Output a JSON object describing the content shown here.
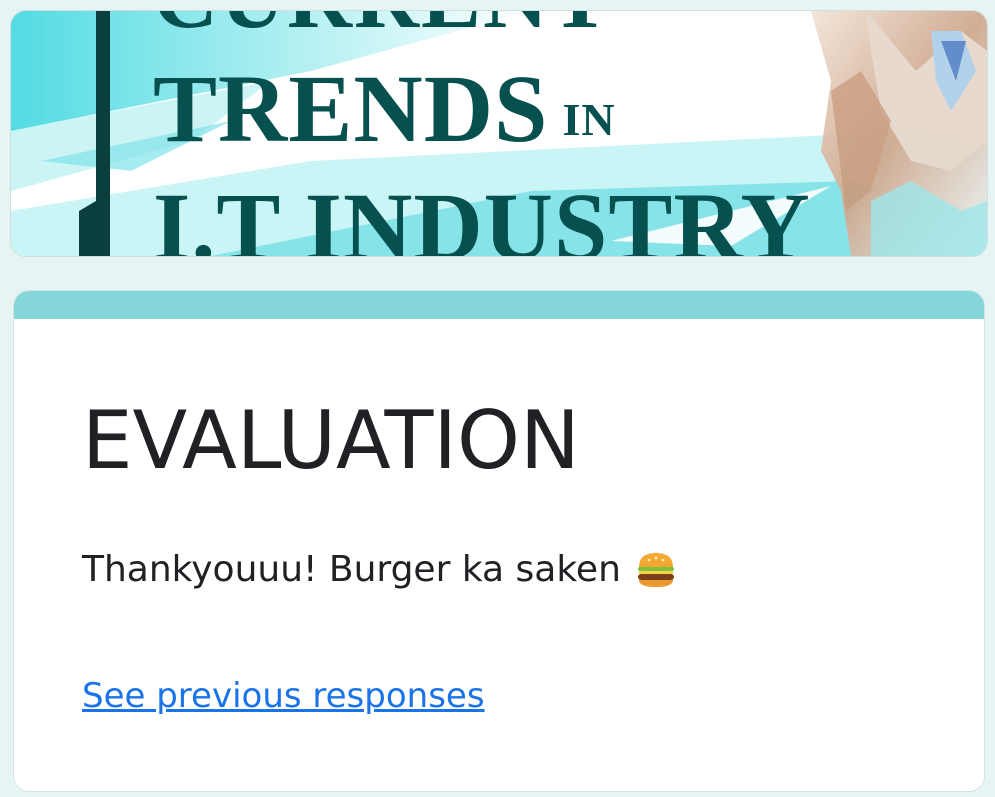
{
  "banner": {
    "line1": "CURRENT",
    "line2_main": "TRENDS",
    "line2_small": "IN",
    "line3": "I.T INDUSTRY",
    "accent_color": "#5fd4dc",
    "text_color": "#06514f"
  },
  "form": {
    "accent_color": "#84d6d8",
    "title": "EVALUATION",
    "confirmation_message": "Thankyouuu! Burger ka saken",
    "message_icon": "burger-icon",
    "link_label": "See previous responses",
    "link_color": "#1a73e8"
  }
}
